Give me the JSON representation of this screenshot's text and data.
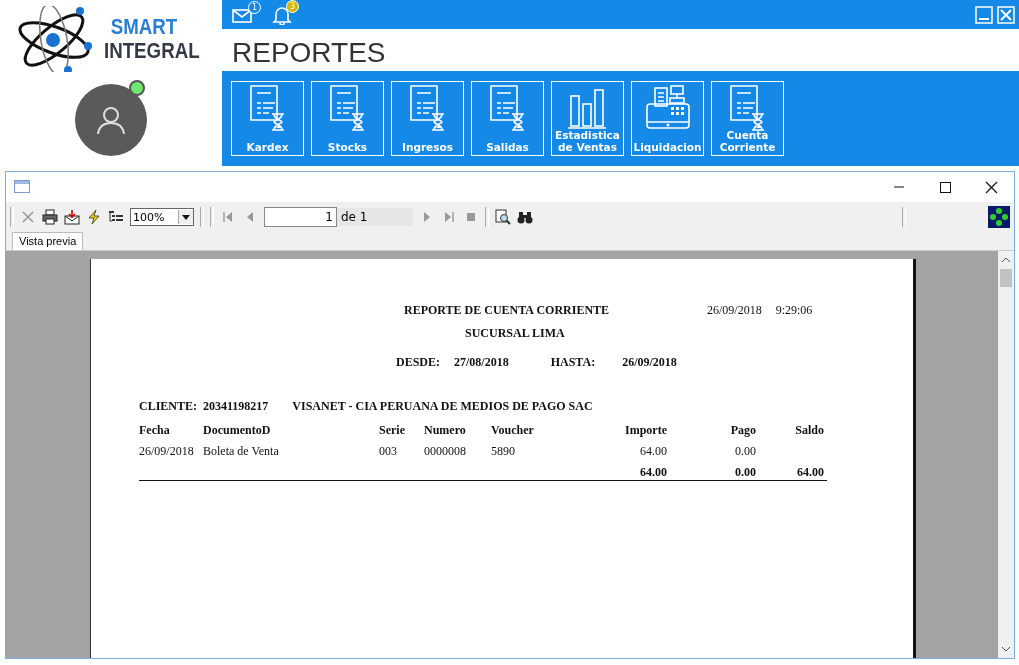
{
  "app": {
    "logo_line1": "SMART",
    "logo_line2": "INTEGRAL",
    "user_online": true
  },
  "topbar": {
    "mail_badge": "1",
    "bell_badge": "3"
  },
  "page_title": "REPORTES",
  "report_buttons": [
    {
      "label": "Kardex",
      "kind": "document"
    },
    {
      "label": "Stocks",
      "kind": "document"
    },
    {
      "label": "Ingresos",
      "kind": "document"
    },
    {
      "label": "Salidas",
      "kind": "document"
    },
    {
      "label": "Estadistica de Ventas",
      "kind": "chart"
    },
    {
      "label": "Liquidacion",
      "kind": "register"
    },
    {
      "label": "Cuenta Corriente",
      "kind": "document"
    }
  ],
  "preview": {
    "tab": "Vista previa",
    "zoom": "100%",
    "page": "1",
    "page_of": "de 1",
    "report": {
      "title": "REPORTE DE CUENTA CORRIENTE",
      "date": "26/09/2018",
      "time": "9:29:06",
      "branch": "SUCURSAL LIMA",
      "from_label": "DESDE:",
      "from": "27/08/2018",
      "to_label": "HASTA:",
      "to": "26/09/2018",
      "client_label": "CLIENTE:",
      "client_id": "20341198217",
      "client_name": "VISANET - CIA PERUANA DE MEDIOS DE PAGO SAC",
      "columns": [
        "Fecha",
        "DocumentoD",
        "Serie",
        "Numero",
        "Voucher",
        "Importe",
        "Pago",
        "Saldo"
      ],
      "rows": [
        {
          "cells": [
            "26/09/2018",
            "Boleta de Venta",
            "003",
            "0000008",
            "5890",
            "64.00",
            "0.00"
          ]
        }
      ],
      "totals": {
        "importe": "64.00",
        "pago": "0.00",
        "saldo": "64.00"
      }
    }
  }
}
